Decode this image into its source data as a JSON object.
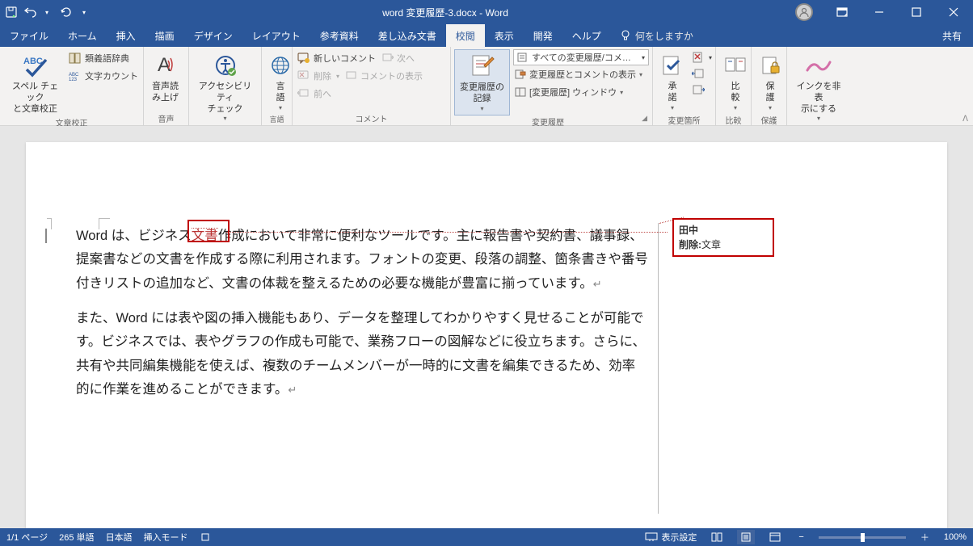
{
  "titlebar": {
    "title": "word 変更履歴-3.docx  -  Word"
  },
  "tabs": {
    "file": "ファイル",
    "home": "ホーム",
    "insert": "挿入",
    "draw": "描画",
    "design": "デザイン",
    "layout": "レイアウト",
    "references": "参考資料",
    "mailings": "差し込み文書",
    "review": "校閲",
    "view": "表示",
    "developer": "開発",
    "help": "ヘルプ",
    "tellme": "何をしますか"
  },
  "share": "共有",
  "ribbon": {
    "grp_proofing": "文章校正",
    "spelling": "スペル チェック\nと文章校正",
    "thesaurus": "類義語辞典",
    "wordcount": "文字カウント",
    "grp_speech": "音声",
    "readaloud": "音声読\nみ上げ",
    "grp_accessibility": "アクセシビリティ",
    "a11y": "アクセシビリティ\nチェック",
    "grp_language": "言語",
    "language": "言\n語",
    "grp_comments": "コメント",
    "newcomment": "新しいコメント",
    "delete": "削除",
    "prevcomment": "前へ",
    "nextcomment": "次へ",
    "showcomments": "コメントの表示",
    "grp_tracking": "変更履歴",
    "trackchanges": "変更履歴の\n記録",
    "display_all": "すべての変更履歴/コメ…",
    "showmarkup": "変更履歴とコメントの表示",
    "reviewpane": "[変更履歴] ウィンドウ",
    "grp_changes": "変更箇所",
    "accept": "承\n諾",
    "grp_compare": "比較",
    "compare": "比\n較",
    "grp_protect": "保護",
    "protect": "保\n護",
    "grp_ink": "インク",
    "hideink": "インクを非表\n示にする",
    "prev": "前へ",
    "next": "次へ"
  },
  "document": {
    "p1_pre": "Word は、ビジネス",
    "p1_track": "文書",
    "p1_post": "作成において非常に便利なツールです。主に報告書や契約書、議事録、提案書などの文書を作成する際に利用されます。フォントの変更、段落の調整、箇条書きや番号付きリストの追加など、文書の体裁を整えるための必要な機能が豊富に揃っています。",
    "p2": "また、Word には表や図の挿入機能もあり、データを整理してわかりやすく見せることが可能です。ビジネスでは、表やグラフの作成も可能で、業務フローの図解などに役立ちます。さらに、共有や共同編集機能を使えば、複数のチームメンバーが一時的に文書を編集できるため、効率的に作業を進めることができます。"
  },
  "revision": {
    "author": "田中",
    "action": "削除:",
    "content": "文章"
  },
  "statusbar": {
    "page": "1/1 ページ",
    "words": "265 単語",
    "lang": "日本語",
    "mode": "挿入モード",
    "display": "表示設定",
    "zoom": "100%"
  }
}
